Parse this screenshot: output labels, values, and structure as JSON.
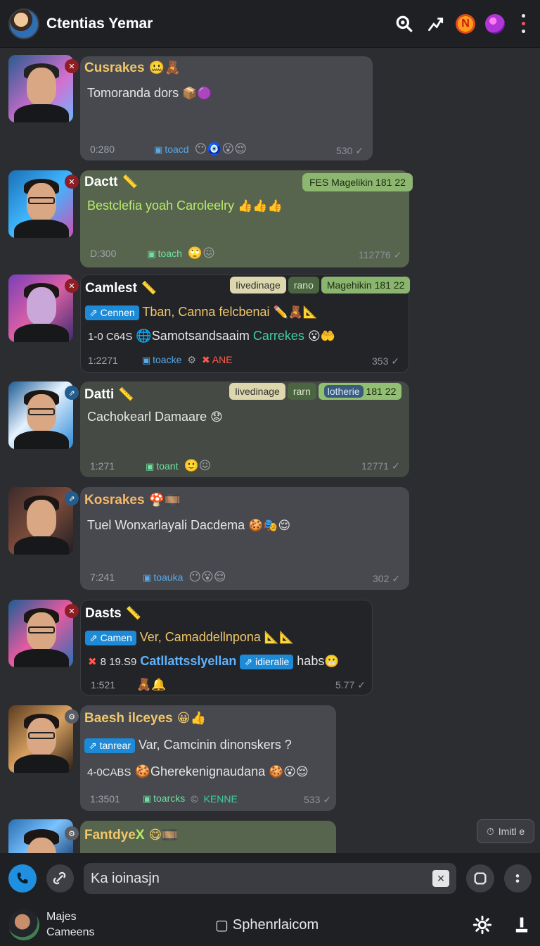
{
  "header": {
    "title": "Ctentias Yemar",
    "icons": [
      "search-icon",
      "share-icon",
      "n-badge-icon",
      "orb-icon",
      "more-icon"
    ]
  },
  "messages": [
    {
      "name": "Cusrakes",
      "name_emoji": "🤐🧸",
      "line1": "Tomoranda dors",
      "line1_emoji": "📦🟣",
      "meta_time": "0:280",
      "meta_tag": "toacd",
      "meta_emoji": "😶🧿😮😌",
      "stamp": "530"
    },
    {
      "name": "Dactt",
      "name_emoji": "📏",
      "quote": "FES Magelikin 181 22",
      "line1": "Bestclefia yoah Caroleelry",
      "line1_emoji": "👍👍👍",
      "meta_time": "D:300",
      "meta_tag": "toach",
      "meta_emoji": "🙄😖",
      "stamp": "112776"
    },
    {
      "name": "Camlest",
      "name_emoji": "📏",
      "head_light": "Iivedinage",
      "head_olive": "rano",
      "head_lime": "Magehikin 181 22",
      "pill": "Cennen",
      "line1": "Tban, Canna felcbenai",
      "line1_emoji": "✏️🧸📐",
      "line2_prefix": "1-0 C64S",
      "line2": "Samotsandsaaim",
      "line2_green": "Carrekes",
      "line2_emoji": "😮🤲",
      "meta_time": "1:2271",
      "meta_tag": "toacke",
      "meta_extra": "ANE",
      "stamp": "353"
    },
    {
      "name": "Datti",
      "name_emoji": "📏",
      "head_light": "Iivedinage",
      "head_olive": "rarn",
      "head_navy": "lotherie",
      "head_num": "181 22",
      "line1": "Cachokearl Damaare",
      "line1_emoji": "😟",
      "meta_time": "1:271",
      "meta_tag": "toant",
      "meta_emoji": "🙂😖",
      "stamp": "12771"
    },
    {
      "name": "Kosrakes",
      "name_emoji": "🍄🎞️",
      "line1": "Tuel Wonxarlayali Dacdema",
      "line1_emoji": "🍪🎭😌",
      "meta_time": "7:241",
      "meta_tag": "toauka",
      "meta_emoji": "😶😮😌",
      "stamp": "302"
    },
    {
      "name": "Dasts",
      "name_emoji": "📏",
      "pill": "Camen",
      "line1": "Ver, Camaddellnpona",
      "line1_emoji": "📐📐",
      "line2_prefix": "8 19.S9",
      "line2": "Catllattsslyellan",
      "pill2": "idieralie",
      "line2_after": "habs",
      "line2_emoji": "😬",
      "meta_time": "1:521",
      "meta_emoji": "🧸🔔",
      "stamp": "5.77"
    },
    {
      "name": "Baesh ilceyes",
      "name_emoji": "😀👍",
      "pill": "tanrear",
      "line1": "Var, Camcinin dinonskers ?",
      "line2_prefix": "4-0CABS",
      "line2": "Gherekenignaudana",
      "line2_emoji": "🍪😮😌",
      "meta_time": "1:3501",
      "meta_tag": "toarcks",
      "meta_extra": "KENNE",
      "stamp": "533"
    },
    {
      "name": "Fantdye",
      "name_x": "X",
      "name_emoji": "😋🎞️"
    }
  ],
  "float_chip": "Imitl e",
  "composer": {
    "placeholder": "Ka ioinasjn"
  },
  "footer": {
    "user_line1": "Majes",
    "user_line2": "Cameens",
    "center": "Sphenrlaicom"
  }
}
